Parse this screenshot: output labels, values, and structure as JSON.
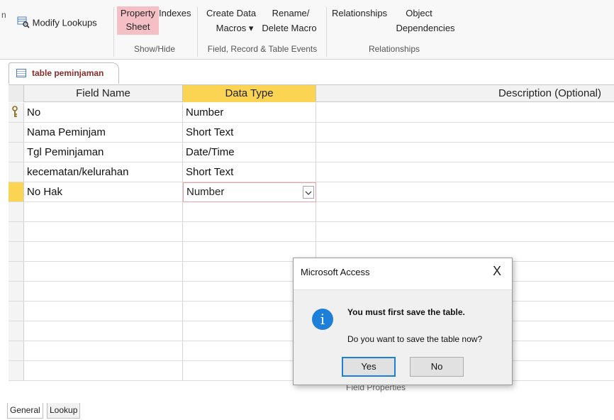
{
  "ribbon": {
    "fragment": "n",
    "modify_lookups": "Modify Lookups",
    "property": "Property",
    "sheet": "Sheet",
    "indexes": "Indexes",
    "create_data": "Create Data",
    "macros": "Macros ▾",
    "rename": "Rename/",
    "delete_macro": "Delete Macro",
    "relationships": "Relationships",
    "object": "Object",
    "dependencies": "Dependencies",
    "groups": {
      "show_hide": "Show/Hide",
      "field_record": "Field, Record & Table Events",
      "relationships": "Relationships"
    }
  },
  "tab": {
    "label": "table peminjaman"
  },
  "grid": {
    "headers": {
      "field_name": "Field Name",
      "data_type": "Data Type",
      "description": "Description (Optional)"
    },
    "rows": [
      {
        "field": "No",
        "type": "Number",
        "desc": ""
      },
      {
        "field": "Nama Peminjam",
        "type": "Short Text",
        "desc": ""
      },
      {
        "field": "Tgl Peminjaman",
        "type": "Date/Time",
        "desc": ""
      },
      {
        "field": "kecematan/kelurahan",
        "type": "Short Text",
        "desc": ""
      },
      {
        "field": "No Hak",
        "type": "Number",
        "desc": ""
      }
    ]
  },
  "field_properties": "Field Properties",
  "bottom_tabs": {
    "general": "General",
    "lookup": "Lookup"
  },
  "dialog": {
    "title": "Microsoft Access",
    "close": "X",
    "message_bold": "You must first save the table.",
    "message": "Do you want to save the table now?",
    "yes": "Yes",
    "no": "No"
  },
  "colors": {
    "accent": "#fbd454",
    "highlight": "#f4c0c6",
    "info": "#1e7fd8"
  }
}
